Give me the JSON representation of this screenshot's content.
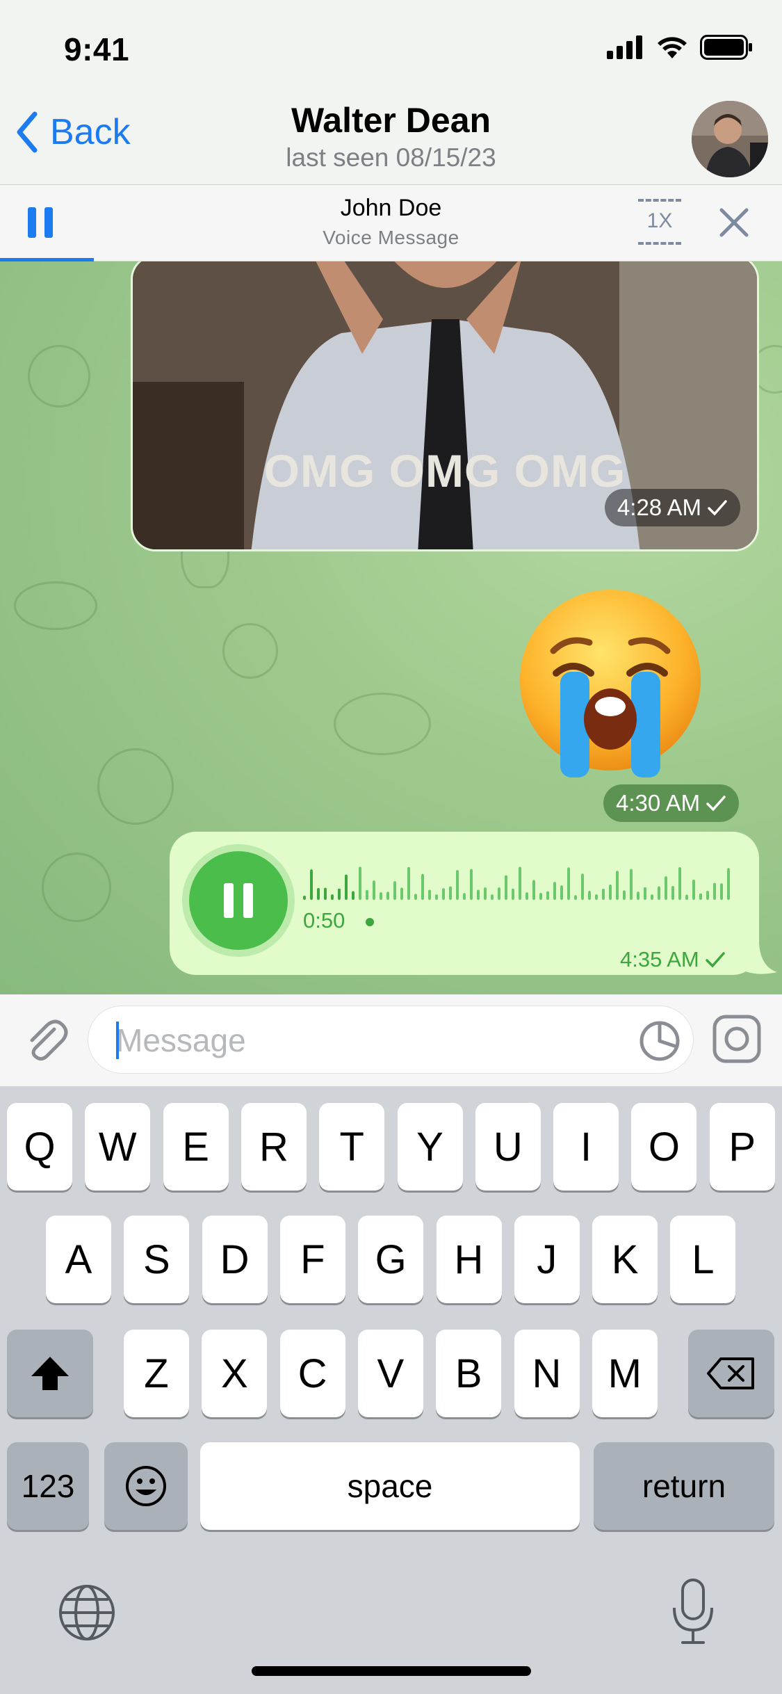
{
  "status_bar": {
    "time": "9:41"
  },
  "nav": {
    "back_label": "Back",
    "title": "Walter Dean",
    "subtitle": "last seen 08/15/23"
  },
  "player": {
    "title": "John Doe",
    "subtitle": "Voice Message",
    "speed": "1X",
    "progress_fraction": 0.12
  },
  "messages": [
    {
      "type": "gif",
      "caption": "OMG OMG OMG",
      "time": "4:28 AM"
    },
    {
      "type": "sticker",
      "emoji": "😭",
      "time": "4:30 AM"
    },
    {
      "type": "voice",
      "duration": "0:50",
      "time": "4:35 AM",
      "state": "playing"
    }
  ],
  "input": {
    "placeholder": "Message",
    "value": ""
  },
  "keyboard": {
    "row1": [
      "Q",
      "W",
      "E",
      "R",
      "T",
      "Y",
      "U",
      "I",
      "O",
      "P"
    ],
    "row2": [
      "A",
      "S",
      "D",
      "F",
      "G",
      "H",
      "J",
      "K",
      "L"
    ],
    "row3": [
      "Z",
      "X",
      "C",
      "V",
      "B",
      "N",
      "M"
    ],
    "numbers_label": "123",
    "space_label": "space",
    "return_label": "return"
  },
  "colors": {
    "accent": "#1d7bf0",
    "voice_green": "#4bbd4b",
    "voice_bubble": "#e2fbcb"
  }
}
